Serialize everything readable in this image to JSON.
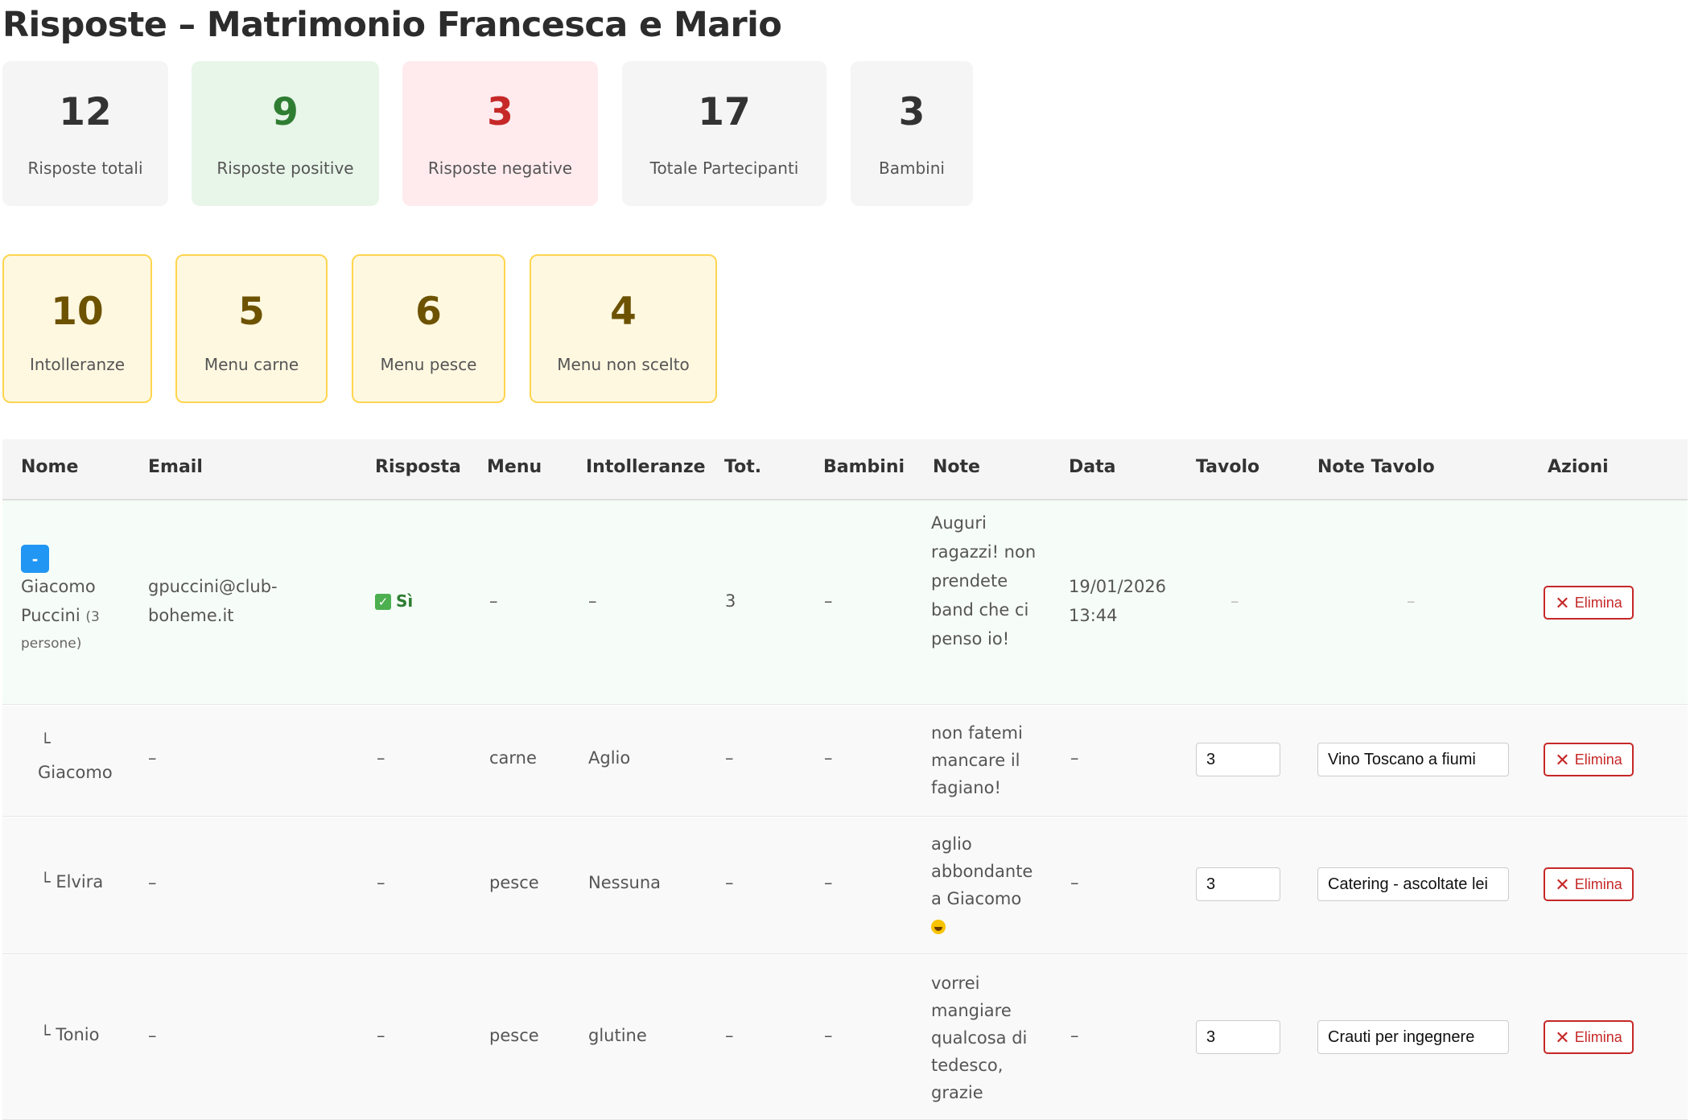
{
  "title": "Risposte – Matrimonio Francesca e Mario",
  "stats": [
    {
      "value": "12",
      "label": "Risposte totali"
    },
    {
      "value": "9",
      "label": "Risposte positive"
    },
    {
      "value": "3",
      "label": "Risposte negative"
    },
    {
      "value": "17",
      "label": "Totale Partecipanti"
    },
    {
      "value": "3",
      "label": "Bambini"
    }
  ],
  "menu_stats": [
    {
      "value": "10",
      "label": "Intolleranze"
    },
    {
      "value": "5",
      "label": "Menu carne"
    },
    {
      "value": "6",
      "label": "Menu pesce"
    },
    {
      "value": "4",
      "label": "Menu non scelto"
    }
  ],
  "columns": [
    "Nome",
    "Email",
    "Risposta",
    "Menu",
    "Intolleranze",
    "Tot.",
    "Bambini",
    "Note",
    "Data",
    "Tavolo",
    "Note Tavolo",
    "Azioni"
  ],
  "main_row": {
    "toggle": "-",
    "name_line1": "Giacomo",
    "name_line2": "Puccini",
    "persons_a": "(3",
    "persons_b": "persone)",
    "email_line1": "gpuccini@club-",
    "email_line2": "boheme.it",
    "risposta_icon": "✓",
    "risposta": "Sì",
    "menu": "–",
    "intolleranze": "–",
    "tot": "3",
    "bambini": "–",
    "note": "Auguri ragazzi! non prendete band che ci penso io!",
    "data_line1": "19/01/2026",
    "data_line2": "13:44",
    "tavolo": "–",
    "note_tavolo": "–",
    "azioni": "Elimina"
  },
  "sub_rows": [
    {
      "prefix": "└",
      "name": "Giacomo",
      "email": "–",
      "risposta": "–",
      "menu": "carne",
      "intolleranze": "Aglio",
      "tot": "–",
      "bambini": "–",
      "note": "non fatemi mancare il fagiano!",
      "data": "–",
      "tavolo": "3",
      "note_tavolo": "Vino Toscano a fiumi",
      "azioni": "Elimina"
    },
    {
      "prefix": "└",
      "name": "Elvira",
      "email": "–",
      "risposta": "–",
      "menu": "pesce",
      "intolleranze": "Nessuna",
      "tot": "–",
      "bambini": "–",
      "note": "aglio abbondante a Giacomo",
      "note_emoji": "smiley-icon",
      "data": "–",
      "tavolo": "3",
      "note_tavolo": "Catering - ascoltate lei",
      "azioni": "Elimina"
    },
    {
      "prefix": "└",
      "name": "Tonio",
      "email": "–",
      "risposta": "–",
      "menu": "pesce",
      "intolleranze": "glutine",
      "tot": "–",
      "bambini": "–",
      "note": "vorrei mangiare qualcosa di tedesco, grazie",
      "data": "–",
      "tavolo": "3",
      "note_tavolo": "Crauti per ingegnere",
      "azioni": "Elimina"
    }
  ],
  "colors": {
    "positive": "#2e7d32",
    "negative": "#c62828",
    "menu_card_border": "#ffd54f",
    "toggle": "#2196f3"
  }
}
